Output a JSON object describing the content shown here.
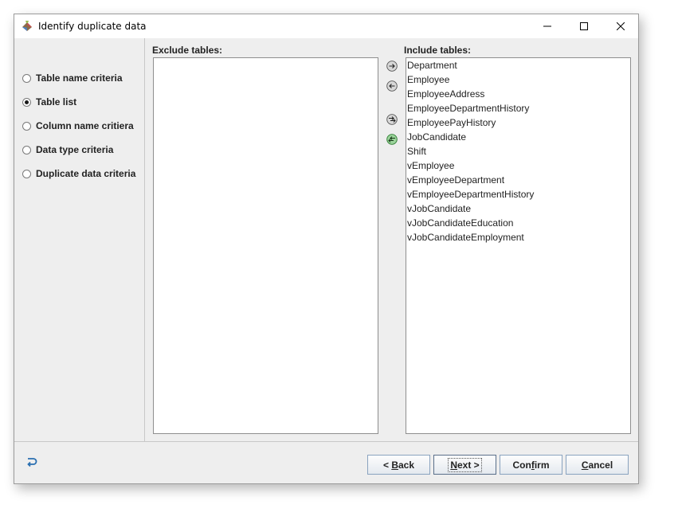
{
  "window": {
    "title": "Identify duplicate data"
  },
  "sidebar": {
    "items": [
      {
        "label": "Table name criteria",
        "selected": false
      },
      {
        "label": "Table list",
        "selected": true
      },
      {
        "label": "Column name critiera",
        "selected": false
      },
      {
        "label": "Data type criteria",
        "selected": false
      },
      {
        "label": "Duplicate data criteria",
        "selected": false
      }
    ]
  },
  "exclude": {
    "label": "Exclude tables:",
    "items": []
  },
  "include": {
    "label": "Include tables:",
    "items": [
      "Department",
      "Employee",
      "EmployeeAddress",
      "EmployeeDepartmentHistory",
      "EmployeePayHistory",
      "JobCandidate",
      "Shift",
      "vEmployee",
      "vEmployeeDepartment",
      "vEmployeeDepartmentHistory",
      "vJobCandidate",
      "vJobCandidateEducation",
      "vJobCandidateEmployment"
    ]
  },
  "buttons": {
    "back": {
      "pre": "< ",
      "mnemonic": "B",
      "post": "ack"
    },
    "next": {
      "pre": "",
      "mnemonic": "N",
      "post": "ext >"
    },
    "confirm": {
      "pre": "Con",
      "mnemonic": "f",
      "post": "irm"
    },
    "cancel": {
      "pre": "",
      "mnemonic": "C",
      "post": "ancel"
    }
  },
  "icons": {
    "app": "app-logo-icon",
    "move_right": "arrow-right-icon",
    "move_left": "arrow-left-icon",
    "move_all_right": "double-arrow-right-icon",
    "move_all_left": "double-arrow-left-icon",
    "undo": "undo-icon"
  }
}
